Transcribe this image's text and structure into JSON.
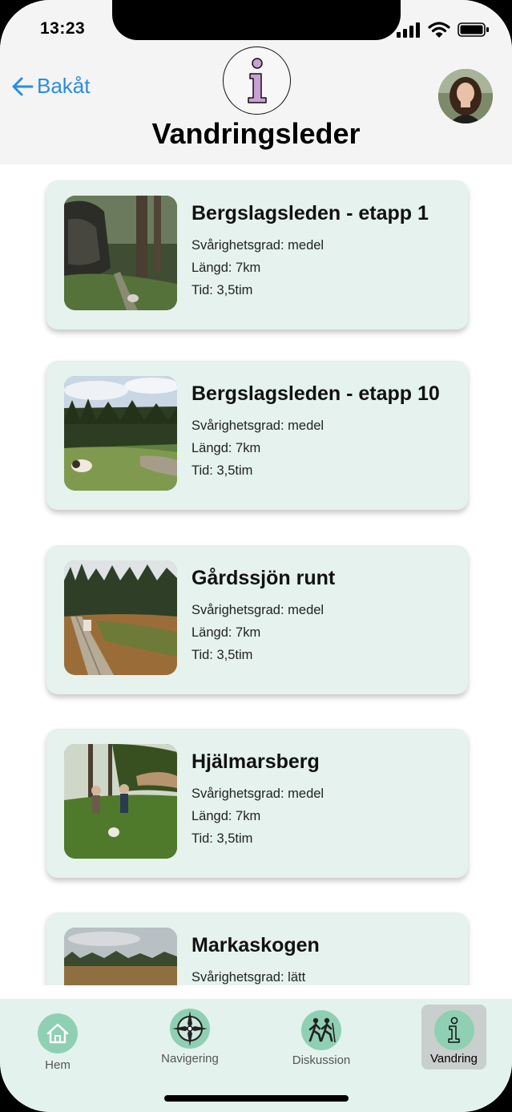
{
  "status": {
    "time": "13:23"
  },
  "header": {
    "back_label": "Bakåt",
    "title": "Vandringsleder",
    "info_glyph": "i"
  },
  "trails": [
    {
      "name": "Bergslagsleden - etapp 1",
      "difficulty": "Svårighetsgrad: medel",
      "length": "Längd: 7km",
      "time": "Tid: 3,5tim",
      "image": "forest-rock-photo"
    },
    {
      "name": "Bergslagsleden - etapp 10",
      "difficulty": "Svårighetsgrad: medel",
      "length": "Längd: 7km",
      "time": "Tid: 3,5tim",
      "image": "hilltop-dog-photo"
    },
    {
      "name": "Gårdssjön runt",
      "difficulty": "Svårighetsgrad: medel",
      "length": "Längd: 7km",
      "time": "Tid: 3,5tim",
      "image": "boardwalk-bog-photo"
    },
    {
      "name": "Hjälmarsberg",
      "difficulty": "Svårighetsgrad: medel",
      "length": "Längd: 7km",
      "time": "Tid: 3,5tim",
      "image": "park-people-photo"
    },
    {
      "name": "Markaskogen",
      "difficulty": "Svårighetsgrad: lätt",
      "length": "",
      "time": "",
      "image": "field-treeline-photo"
    }
  ],
  "tabs": [
    {
      "label": "Hem",
      "icon": "home-icon"
    },
    {
      "label": "Navigering",
      "icon": "compass-icon"
    },
    {
      "label": "Diskussion",
      "icon": "hikers-icon"
    },
    {
      "label": "Vandring",
      "icon": "info-icon",
      "active": true
    }
  ],
  "colors": {
    "card_bg": "#e5f2ed",
    "tabbar_bg": "#e3f2ec",
    "tab_icon_bg": "#8fd0b4",
    "link_blue": "#2b8ddb"
  }
}
